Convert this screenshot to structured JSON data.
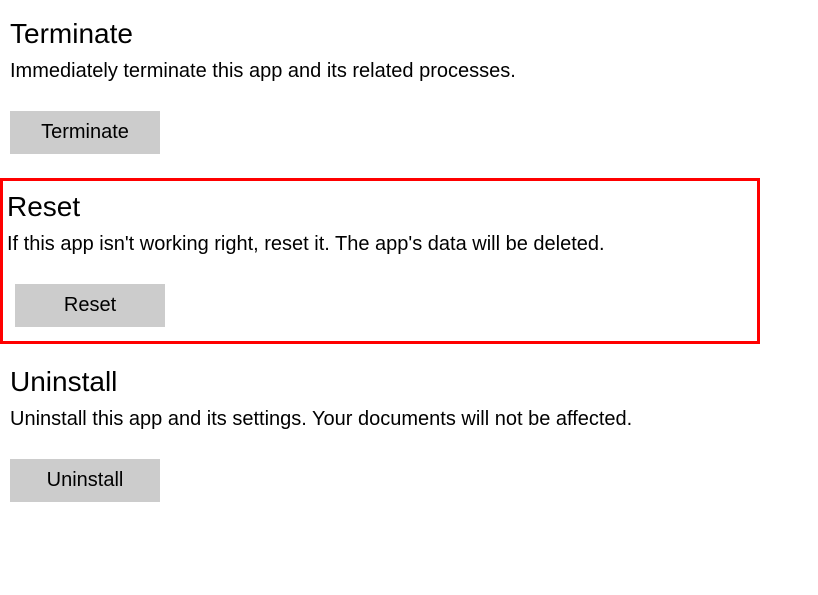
{
  "terminate": {
    "heading": "Terminate",
    "description": "Immediately terminate this app and its related processes.",
    "button_label": "Terminate"
  },
  "reset": {
    "heading": "Reset",
    "description": "If this app isn't working right, reset it. The app's data will be deleted.",
    "button_label": "Reset"
  },
  "uninstall": {
    "heading": "Uninstall",
    "description": "Uninstall this app and its settings. Your documents will not be affected.",
    "button_label": "Uninstall"
  }
}
